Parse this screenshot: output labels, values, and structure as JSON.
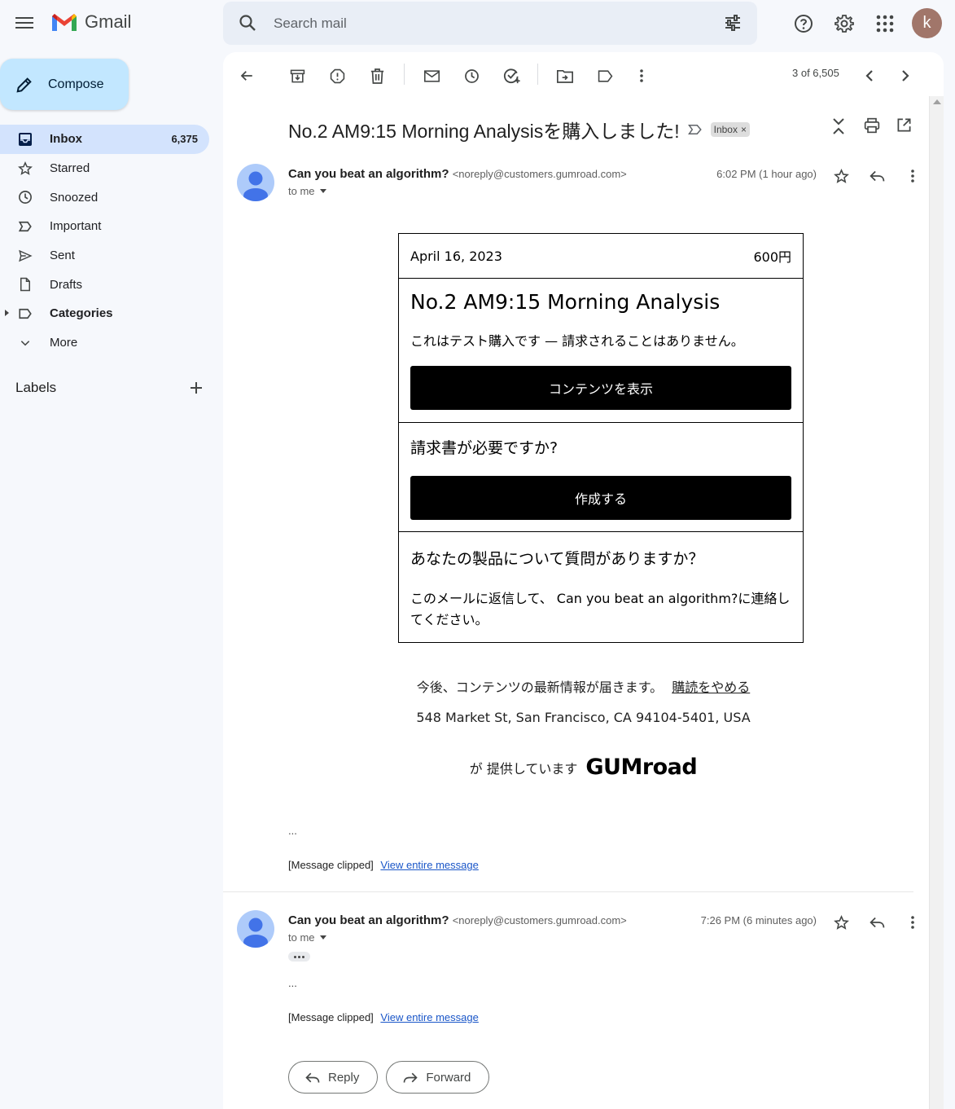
{
  "app": {
    "name": "Gmail"
  },
  "search": {
    "placeholder": "Search mail"
  },
  "user": {
    "avatar_letter": "k"
  },
  "compose": {
    "label": "Compose"
  },
  "nav": {
    "inbox": {
      "label": "Inbox",
      "count": "6,375"
    },
    "starred": {
      "label": "Starred"
    },
    "snoozed": {
      "label": "Snoozed"
    },
    "important": {
      "label": "Important"
    },
    "sent": {
      "label": "Sent"
    },
    "drafts": {
      "label": "Drafts"
    },
    "categories": {
      "label": "Categories"
    },
    "more": {
      "label": "More"
    }
  },
  "labels": {
    "title": "Labels"
  },
  "toolbar": {
    "counter": "3 of 6,505"
  },
  "thread": {
    "subject": "No.2 AM9:15 Morning Analysisを購入しました!",
    "label_badge": "Inbox"
  },
  "message1": {
    "sender_name": "Can you beat an algorithm?",
    "sender_email": "<noreply@customers.gumroad.com>",
    "to": "to me",
    "time": "6:02 PM (1 hour ago)"
  },
  "receipt": {
    "date": "April 16, 2023",
    "price": "600円",
    "product_title": "No.2 AM9:15 Morning Analysis",
    "test_note": "これはテスト購入です — 請求されることはありません。",
    "view_content_button": "コンテンツを表示",
    "invoice_question": "請求書が必要ですか?",
    "create_button": "作成する",
    "question_title": "あなたの製品について質問がありますか？",
    "question_text": "このメールに返信して、 Can you beat an algorithm?に連絡してください。"
  },
  "footer": {
    "updates_text": "今後、コンテンツの最新情報が届きます。",
    "unsubscribe": "購読をやめる",
    "address": "548 Market St, San Francisco, CA 94104-5401, USA",
    "powered_by": "が 提供しています",
    "brand": "GUMroad"
  },
  "clipped": {
    "ellipsis": "...",
    "text": "[Message clipped]",
    "link": "View entire message"
  },
  "message2": {
    "sender_name": "Can you beat an algorithm?",
    "sender_email": "<noreply@customers.gumroad.com>",
    "to": "to me",
    "time": "7:26 PM (6 minutes ago)"
  },
  "actions": {
    "reply": "Reply",
    "forward": "Forward"
  },
  "colors": {
    "compose_bg": "#c2e7ff",
    "active_nav": "#d3e3fd",
    "link": "#1a56c8",
    "avatar_k": "#a1766a"
  }
}
